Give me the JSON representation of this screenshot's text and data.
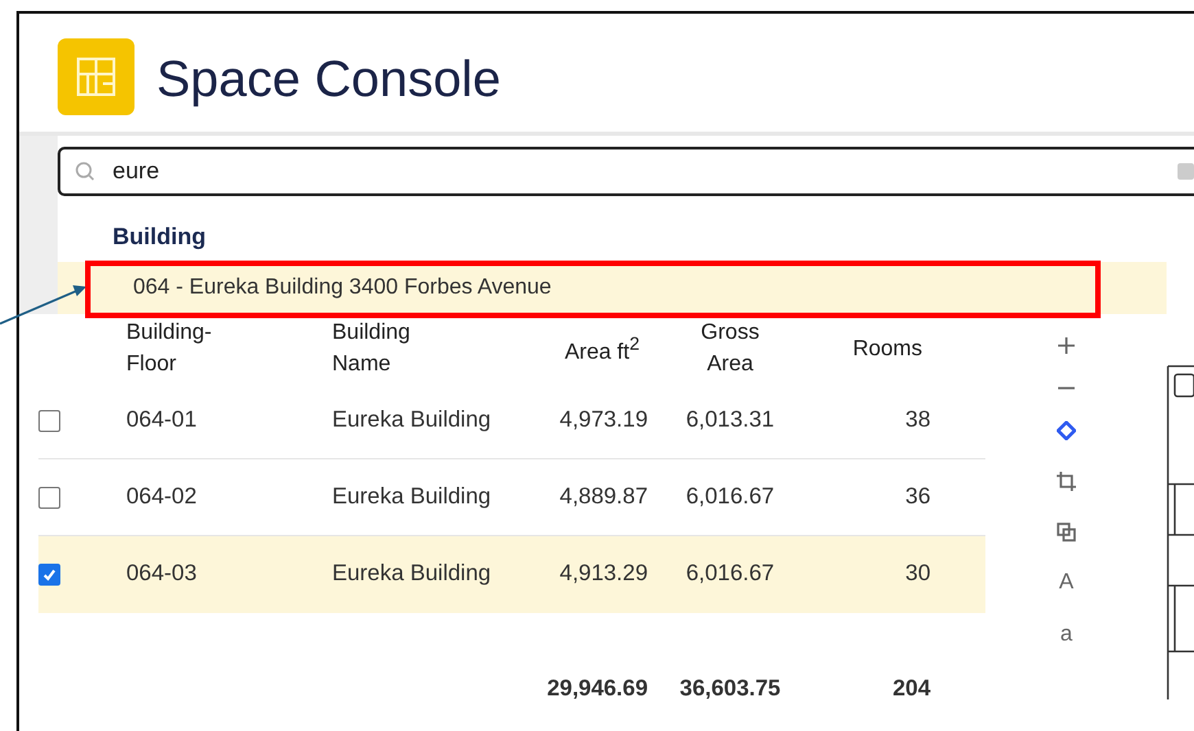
{
  "app": {
    "title": "Space Console"
  },
  "search": {
    "value": "eure"
  },
  "suggestions": {
    "group": "Building",
    "items": [
      {
        "label": "064 - Eureka Building 3400 Forbes Avenue",
        "selected": true
      }
    ]
  },
  "table": {
    "columns": [
      {
        "lines": [
          "Building-",
          "Floor"
        ]
      },
      {
        "lines": [
          "Building",
          "Name"
        ]
      },
      {
        "lines": [
          "Area ft$^{2}$"
        ]
      },
      {
        "lines": [
          "Gross",
          "Area"
        ]
      },
      {
        "lines": [
          "Rooms"
        ]
      }
    ],
    "rows": [
      {
        "checked": false,
        "selected": false,
        "cells": [
          "064-01",
          "Eureka Building",
          "4,973.19",
          "6,013.31",
          "38"
        ]
      },
      {
        "checked": false,
        "selected": false,
        "cells": [
          "064-02",
          "Eureka Building",
          "4,889.87",
          "6,016.67",
          "36"
        ]
      },
      {
        "checked": true,
        "selected": true,
        "cells": [
          "064-03",
          "Eureka Building",
          "4,913.29",
          "6,016.67",
          "30"
        ]
      }
    ],
    "totals": {
      "area": "29,946.69",
      "gross": "36,603.75",
      "rooms": "204"
    }
  },
  "toolbar": [
    {
      "kind": "plus",
      "selected": false
    },
    {
      "kind": "minus",
      "selected": false
    },
    {
      "kind": "locate",
      "selected": true
    },
    {
      "kind": "crop",
      "selected": false
    },
    {
      "kind": "copy",
      "selected": false
    },
    {
      "kind": "text",
      "label": "A",
      "selected": false
    },
    {
      "kind": "text",
      "label": "a",
      "selected": false
    }
  ]
}
